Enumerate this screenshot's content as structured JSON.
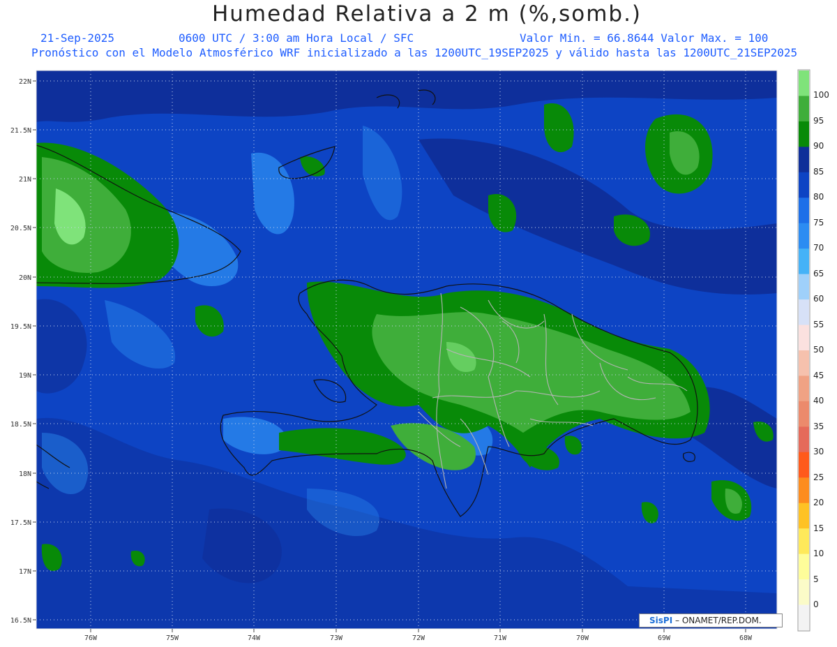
{
  "header": {
    "title": "Humedad Relativa a 2 m (%,somb.)",
    "date": "21-Sep-2025",
    "time_info": "0600 UTC / 3:00 am Hora Local / SFC",
    "value_range": "Valor Min. = 66.8644  Valor Max. = 100",
    "model_info": "Pronóstico con el Modelo Atmosférico WRF inicializado a las 1200UTC_19SEP2025 y válido hasta las  1200UTC_21SEP2025"
  },
  "map": {
    "lat_labels": [
      "22N",
      "21.5N",
      "21N",
      "20.5N",
      "20N",
      "19.5N",
      "19N",
      "18.5N",
      "18N",
      "17.5N",
      "17N",
      "16.5N"
    ],
    "lon_labels": [
      "76W",
      "75W",
      "74W",
      "73W",
      "72W",
      "71W",
      "70W",
      "69W",
      "68W"
    ]
  },
  "colorbar": {
    "levels": [
      "100",
      "95",
      "90",
      "85",
      "80",
      "75",
      "70",
      "65",
      "60",
      "55",
      "50",
      "45",
      "40",
      "35",
      "30",
      "25",
      "20",
      "15",
      "10",
      "5",
      "0"
    ],
    "colors": [
      "#7fe37a",
      "#3fae3a",
      "#088a08",
      "#0f2f99",
      "#0d44c4",
      "#1d6fe8",
      "#2c8cf2",
      "#45b2f7",
      "#9fd0fa",
      "#d7e1f7",
      "#fbe1df",
      "#f6c1ad",
      "#f0a284",
      "#ec8a6c",
      "#e56a5a",
      "#ff5a1c",
      "#fd8c1e",
      "#fec224",
      "#fee95a",
      "#fefd9a",
      "#fbfbc8",
      "#f3f3f3"
    ]
  },
  "credit": {
    "brand": "SisPI",
    "text": "– ONAMET/REP.DOM."
  },
  "colors": {
    "ocean": "#0d44c4",
    "land_rh90": "#088a08",
    "land_rh95": "#3fae3a",
    "land_rh100": "#7fe37a",
    "deep": "#0f2f99",
    "light_blue": "#2c8cf2",
    "header_text": "#1d5cff"
  }
}
